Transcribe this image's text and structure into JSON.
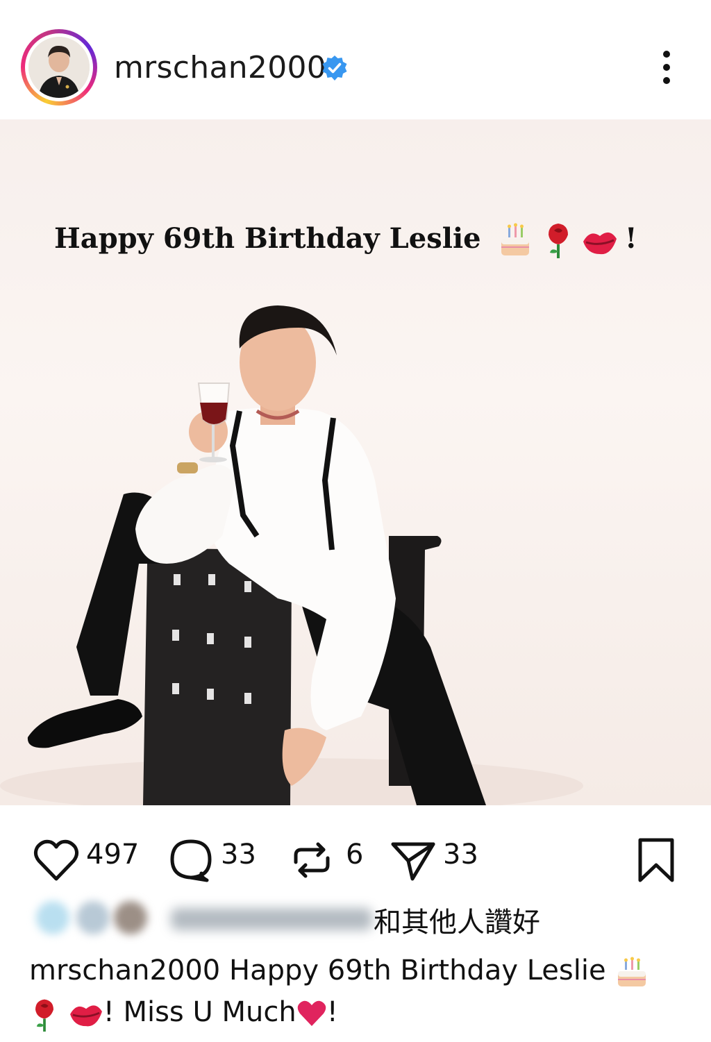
{
  "header": {
    "username": "mrschan2000",
    "verified": true,
    "more_icon": "more-vertical-icon"
  },
  "photo": {
    "overlay_text": "Happy 69th Birthday Leslie",
    "overlay_emojis": [
      "birthday-cake",
      "rose",
      "kiss-mark"
    ],
    "overlay_suffix": "!"
  },
  "actions": {
    "likes_count": "497",
    "comments_count": "33",
    "reposts_count": "6",
    "shares_count": "33"
  },
  "liked_by": {
    "text": "和其他人讚好"
  },
  "caption": {
    "username": "mrschan2000",
    "text_part1": "Happy 69th Birthday Leslie",
    "text_part2": "! Miss U Much",
    "text_part3": "!"
  },
  "colors": {
    "verified_blue": "#3897f0",
    "heart_red": "#e0245e"
  }
}
